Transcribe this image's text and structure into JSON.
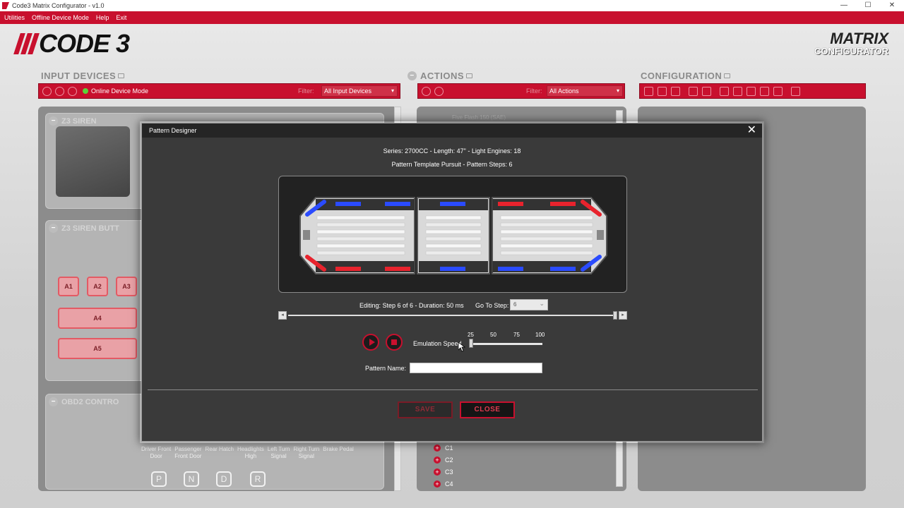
{
  "window": {
    "title": "Code3 Matrix Configurator - v1.0",
    "controls": [
      "—",
      "☐",
      "✕"
    ]
  },
  "menu": {
    "items": [
      "Utilities",
      "Offline Device Mode",
      "Help",
      "Exit"
    ]
  },
  "branding": {
    "logo_text": "CODE 3",
    "product_line1": "MATRIX",
    "product_line2": "CONFIGURATOR"
  },
  "sections": {
    "input_devices": {
      "title": "INPUT DEVICES",
      "mode_label": "Online Device Mode",
      "filter_label": "Filter:",
      "filter_value": "All Input Devices",
      "cards": [
        {
          "title": "Z3 SIREN"
        },
        {
          "title": "Z3 SIREN BUTT"
        },
        {
          "title": "OBD2 CONTRO"
        }
      ],
      "buttons": [
        "A1",
        "A2",
        "A3",
        "A4",
        "A5"
      ],
      "obd_labels": [
        {
          "line1": "Driver Front",
          "line2": "Door"
        },
        {
          "line1": "Passenger",
          "line2": "Front Door"
        },
        {
          "line1": "Rear Hatch",
          "line2": ""
        },
        {
          "line1": "Headlights",
          "line2": "High"
        },
        {
          "line1": "Left Turn",
          "line2": "Signal"
        },
        {
          "line1": "Right Turn",
          "line2": "Signal"
        },
        {
          "line1": "Brake Pedal",
          "line2": ""
        }
      ],
      "recycle_labels": [
        "P",
        "N",
        "D",
        "R"
      ]
    },
    "actions": {
      "title": "ACTIONS",
      "filter_label": "Filter:",
      "filter_value": "All Actions",
      "top_item": "Five Flash 150 (SAE)",
      "items": [
        "C1",
        "C2",
        "C3",
        "C4"
      ]
    },
    "configuration": {
      "title": "CONFIGURATION"
    }
  },
  "dialog": {
    "title": "Pattern Designer",
    "close_glyph": "✕",
    "series_info": "Series: 2700CC - Length: 47\" - Light Engines: 18",
    "pattern_info": "Pattern  Template Pursuit - Pattern Steps: 6",
    "editing_info": "Editing: Step 6 of 6 - Duration: 50 ms",
    "goto_label": "Go To Step:",
    "goto_value": "6",
    "step_prev": "◂",
    "step_next": "▸",
    "step_position": 1.0,
    "emulation_label": "Emulation Speed",
    "emulation_ticks": [
      "25",
      "50",
      "75",
      "100"
    ],
    "emulation_value": 25,
    "pattern_name_label": "Pattern Name:",
    "pattern_name_value": "",
    "save_label": "SAVE",
    "close_label": "CLOSE",
    "colors": {
      "red": "#e8232d",
      "blue": "#2a4bff",
      "accent": "#c8102e"
    }
  }
}
